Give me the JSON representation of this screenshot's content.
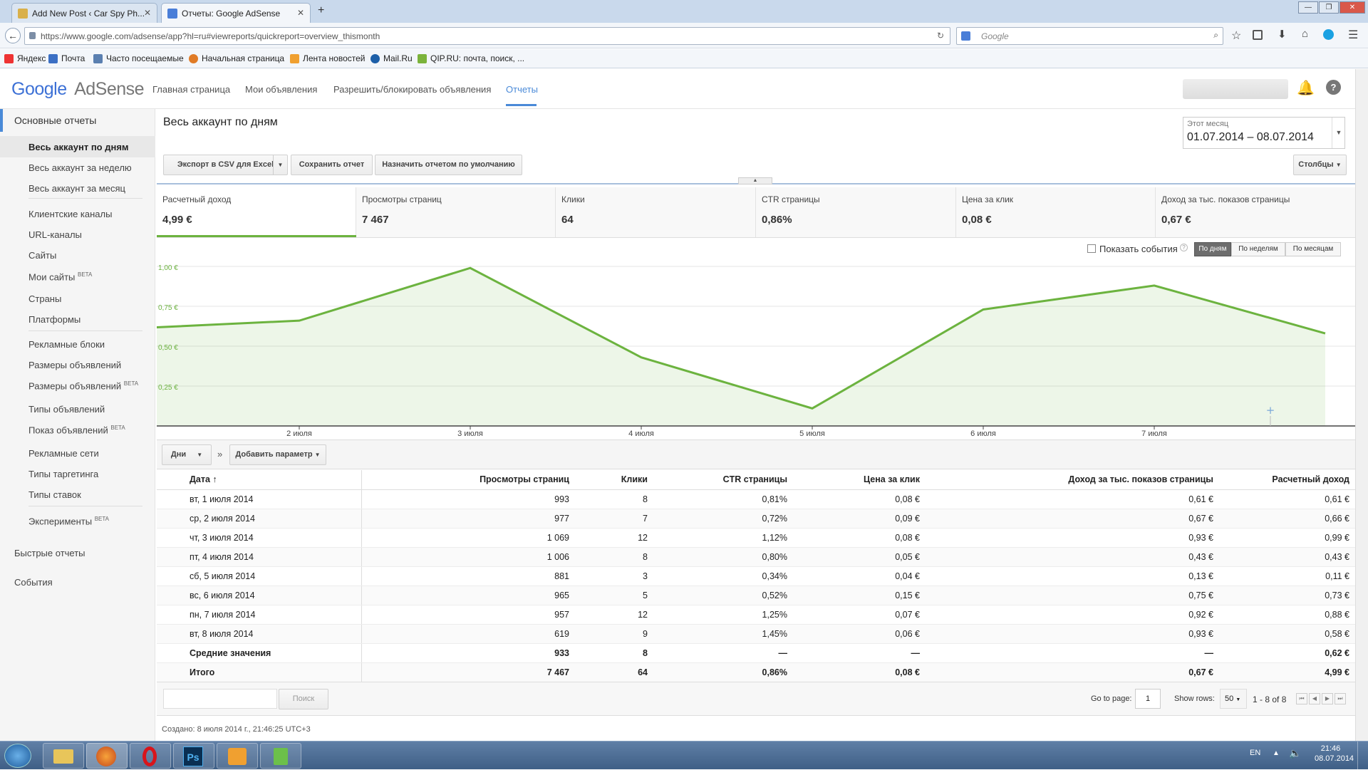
{
  "browser": {
    "tabs": [
      {
        "title": "Add New Post ‹ Car Spy Ph...",
        "active": false
      },
      {
        "title": "Отчеты: Google AdSense",
        "active": true
      }
    ],
    "url": "https://www.google.com/adsense/app?hl=ru#viewreports/quickreport=overview_thismonth",
    "search_placeholder": "Google",
    "bookmarks": [
      "Яндекс",
      "Почта",
      "Часто посещаемые",
      "Начальная страница",
      "Лента новостей",
      "Mail.Ru",
      "QIP.RU: почта, поиск, ..."
    ]
  },
  "app": {
    "logo_google": "Google",
    "logo_product": "AdSense",
    "nav": [
      "Главная страница",
      "Мои объявления",
      "Разрешить/блокировать объявления",
      "Отчеты"
    ],
    "active_nav": "Отчеты"
  },
  "sidebar": {
    "section_title": "Основные отчеты",
    "groups": [
      [
        "Весь аккаунт по дням",
        "Весь аккаунт за неделю",
        "Весь аккаунт за месяц"
      ],
      [
        "Клиентские каналы",
        "URL-каналы",
        "Сайты",
        "Мои сайты",
        "Страны",
        "Платформы"
      ],
      [
        "Рекламные блоки",
        "Размеры объявлений",
        "Размеры объявлений",
        "Типы объявлений",
        "Показ объявлений",
        "Рекламные сети",
        "Типы таргетинга",
        "Типы ставок"
      ],
      [
        "Эксперименты"
      ]
    ],
    "beta_label": "BETA",
    "quick_reports": "Быстрые отчеты",
    "events": "События"
  },
  "report": {
    "title": "Весь аккаунт по дням",
    "period_label": "Этот месяц",
    "period_value": "01.07.2014 – 08.07.2014",
    "btn_export": "Экспорт в CSV для Excel",
    "btn_save": "Сохранить отчет",
    "btn_default": "Назначить отчетом по умолчанию",
    "btn_columns": "Столбцы",
    "show_events": "Показать события",
    "seg": [
      "По дням",
      "По неделям",
      "По месяцам"
    ],
    "dim_button": "Дни",
    "add_param": "Добавить параметр",
    "search_button": "Поиск",
    "goto_label": "Go to page:",
    "goto_value": "1",
    "rows_label": "Show rows:",
    "rows_value": "50",
    "range": "1 - 8 of 8",
    "created": "Создано: 8 июля 2014 г., 21:46:25 UTC+3"
  },
  "kpis": [
    {
      "label": "Расчетный доход",
      "value": "4,99 €"
    },
    {
      "label": "Просмотры страниц",
      "value": "7 467"
    },
    {
      "label": "Клики",
      "value": "64"
    },
    {
      "label": "CTR страницы",
      "value": "0,86%"
    },
    {
      "label": "Цена за клик",
      "value": "0,08 €"
    },
    {
      "label": "Доход за тыс. показов страницы",
      "value": "0,67 €"
    }
  ],
  "chart_data": {
    "type": "area",
    "series": [
      {
        "values": [
          0.61,
          0.66,
          0.99,
          0.43,
          0.11,
          0.73,
          0.88,
          0.58
        ]
      }
    ],
    "x": [
      "1 июля",
      "2 июля",
      "3 июля",
      "4 июля",
      "5 июля",
      "6 июля",
      "7 июля",
      "8 июля"
    ],
    "xticks": [
      "2 июля",
      "3 июля",
      "4 июля",
      "5 июля",
      "6 июля",
      "7 июля"
    ],
    "yticks": [
      "1,00 €",
      "0,75 €",
      "0,50 €",
      "0,25 €"
    ],
    "ylim": [
      0,
      1.0
    ],
    "color": "#6cb33f",
    "grid": true
  },
  "table": {
    "headers": [
      "Дата",
      "Просмотры страниц",
      "Клики",
      "CTR страницы",
      "Цена за клик",
      "Доход за тыс. показов страницы",
      "Расчетный доход"
    ],
    "rows": [
      [
        "вт, 1 июля 2014",
        "993",
        "8",
        "0,81%",
        "0,08 €",
        "0,61 €",
        "0,61 €"
      ],
      [
        "ср, 2 июля 2014",
        "977",
        "7",
        "0,72%",
        "0,09 €",
        "0,67 €",
        "0,66 €"
      ],
      [
        "чт, 3 июля 2014",
        "1 069",
        "12",
        "1,12%",
        "0,08 €",
        "0,93 €",
        "0,99 €"
      ],
      [
        "пт, 4 июля 2014",
        "1 006",
        "8",
        "0,80%",
        "0,05 €",
        "0,43 €",
        "0,43 €"
      ],
      [
        "сб, 5 июля 2014",
        "881",
        "3",
        "0,34%",
        "0,04 €",
        "0,13 €",
        "0,11 €"
      ],
      [
        "вс, 6 июля 2014",
        "965",
        "5",
        "0,52%",
        "0,15 €",
        "0,75 €",
        "0,73 €"
      ],
      [
        "пн, 7 июля 2014",
        "957",
        "12",
        "1,25%",
        "0,07 €",
        "0,92 €",
        "0,88 €"
      ],
      [
        "вт, 8 июля 2014",
        "619",
        "9",
        "1,45%",
        "0,06 €",
        "0,93 €",
        "0,58 €"
      ]
    ],
    "avg": [
      "Средние значения",
      "933",
      "8",
      "—",
      "—",
      "—",
      "0,62 €"
    ],
    "total": [
      "Итого",
      "7 467",
      "64",
      "0,86%",
      "0,08 €",
      "0,67 €",
      "4,99 €"
    ]
  },
  "taskbar": {
    "lang": "EN",
    "time": "21:46",
    "date": "08.07.2014"
  }
}
